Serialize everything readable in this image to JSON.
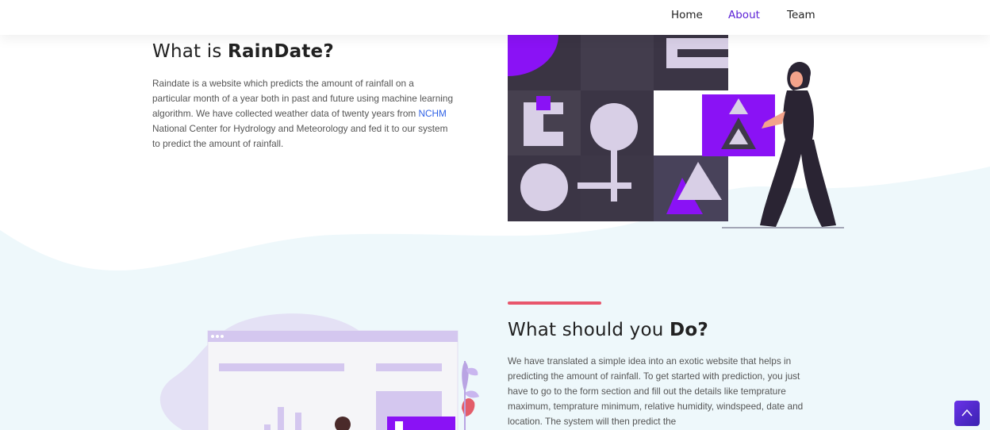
{
  "nav": {
    "items": [
      {
        "label": "Home",
        "active": false
      },
      {
        "label": "About",
        "active": true
      },
      {
        "label": "Team",
        "active": false
      }
    ]
  },
  "about": {
    "title_prefix": "What is ",
    "title_bold": "RainDate?",
    "body_before_link": "Raindate is a website which predicts the amount of rainfall on a particular month of a year both in past and future using machine learning algorithm. We have collected weather data of twenty years from ",
    "link_text": "NCHM",
    "body_after_link": " National Center for Hydrology and Meteorology and fed it to our system to predict the amount of rainfall."
  },
  "todo": {
    "title_prefix": "What should you ",
    "title_bold": "Do?",
    "body": "We have translated a simple idea into an exotic website that helps in predicting the amount of rainfall. To get started with prediction, you just have to go to the form section and fill out the details like temprature maximum, temprature minimum, relative humidity, windspeed, date and location. The system will then predict the"
  },
  "colors": {
    "accent_purple": "#8a12f5",
    "nav_active": "#5a1fd6",
    "accent_bar": "#e8566c",
    "link": "#2f62e6",
    "wave_bg": "#eff8fb"
  },
  "icons": {
    "scroll_top": "chevron-up-icon"
  }
}
